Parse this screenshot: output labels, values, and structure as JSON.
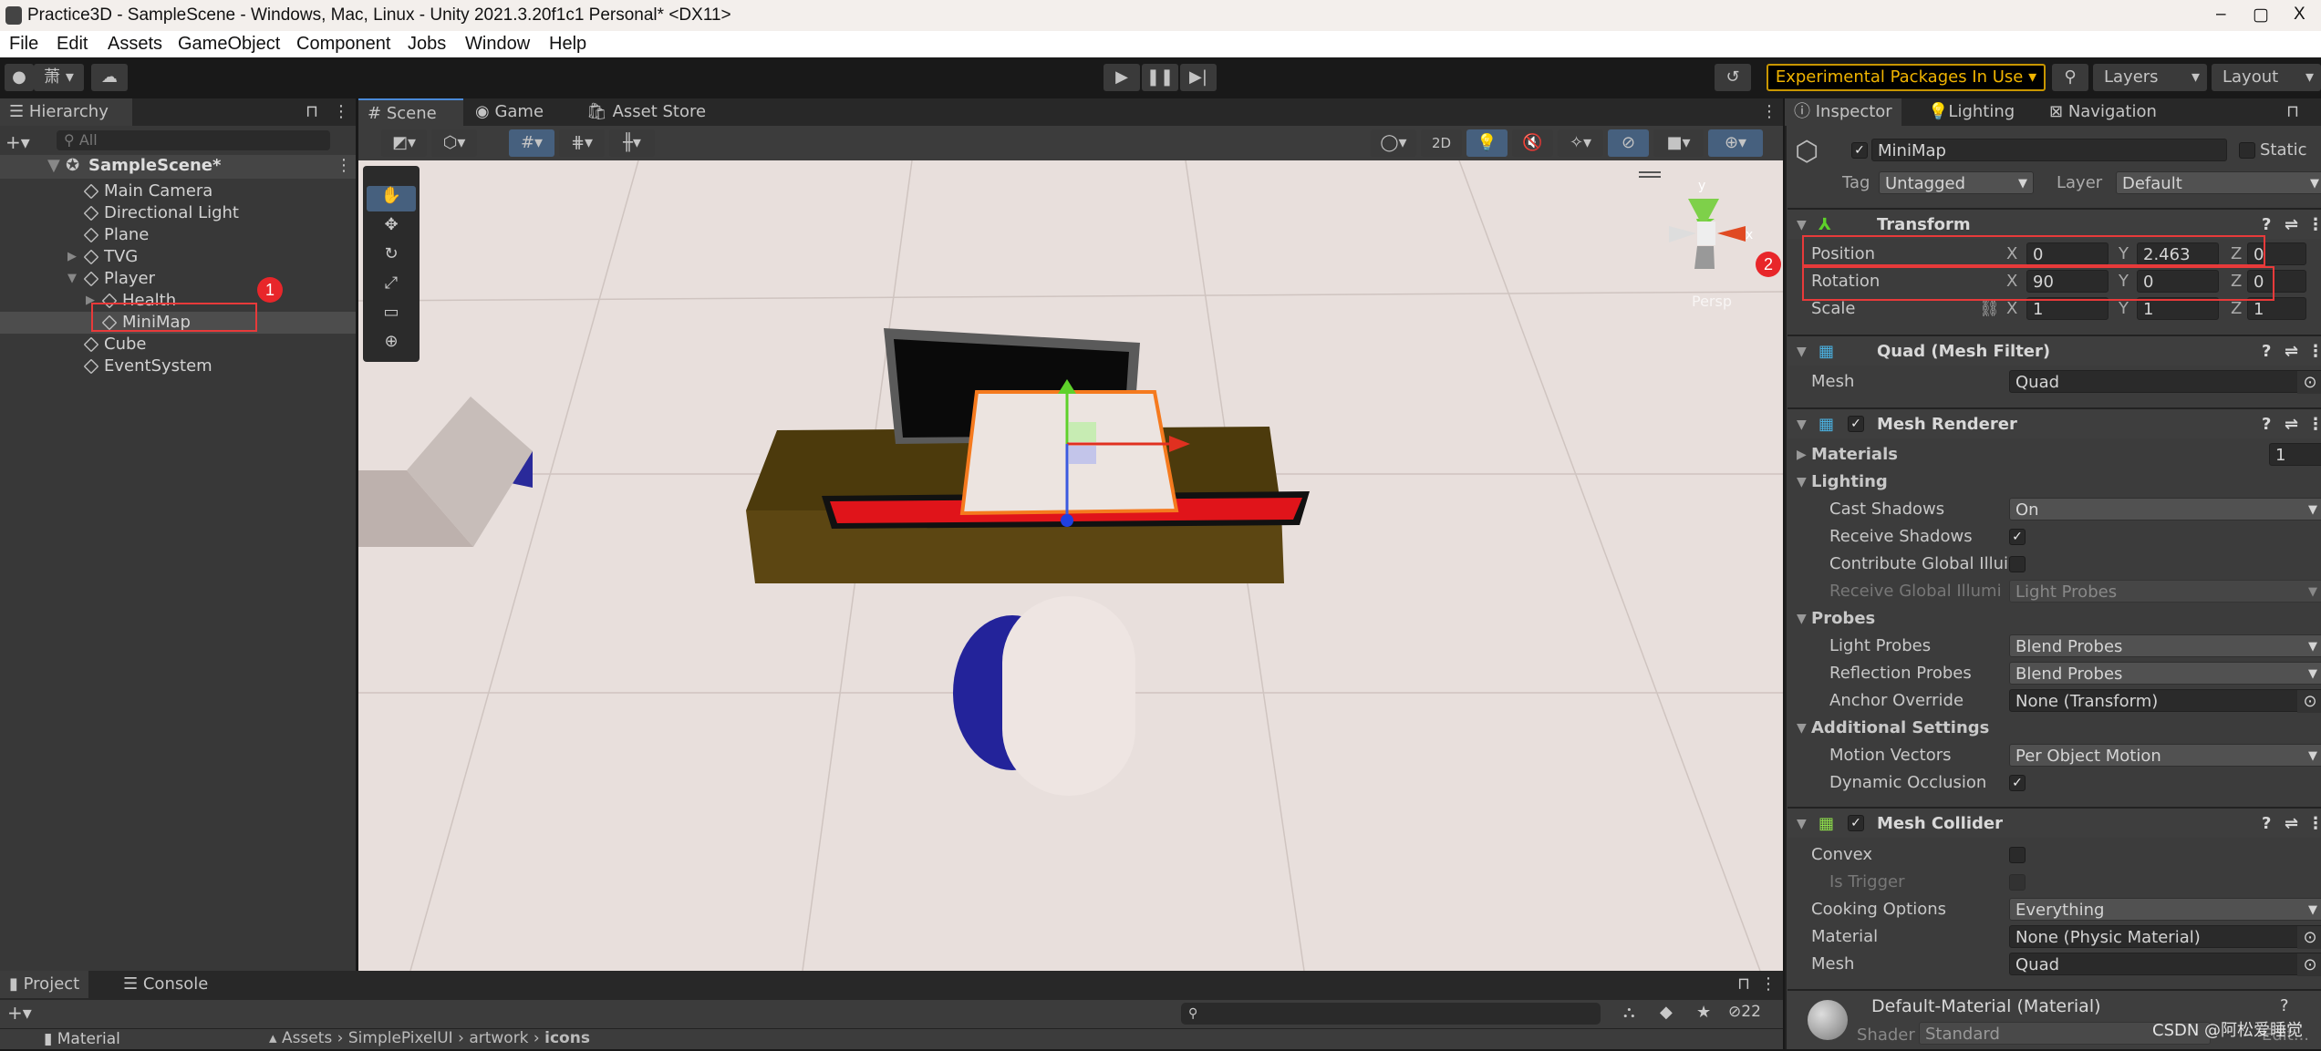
{
  "window": {
    "title": "Practice3D - SampleScene - Windows, Mac, Linux - Unity 2021.3.20f1c1 Personal* <DX11>",
    "controls": [
      "–",
      "▢",
      "X"
    ]
  },
  "menu": [
    "File",
    "Edit",
    "Assets",
    "GameObject",
    "Component",
    "Jobs",
    "Window",
    "Help"
  ],
  "toolbar": {
    "account": "萧",
    "experimental": "Experimental Packages In Use ▾",
    "layers": "Layers",
    "layout": "Layout"
  },
  "hierarchy": {
    "tab": "Hierarchy",
    "search_placeholder": "All",
    "scene": "SampleScene*",
    "items": [
      {
        "label": "Main Camera",
        "depth": 1
      },
      {
        "label": "Directional Light",
        "depth": 1
      },
      {
        "label": "Plane",
        "depth": 1
      },
      {
        "label": "TVG",
        "depth": 1,
        "arrow": "▶"
      },
      {
        "label": "Player",
        "depth": 1,
        "arrow": "▼"
      },
      {
        "label": "Health",
        "depth": 2,
        "arrow": "▶"
      },
      {
        "label": "MiniMap",
        "depth": 2,
        "selected": true
      },
      {
        "label": "Cube",
        "depth": 1
      },
      {
        "label": "EventSystem",
        "depth": 1
      }
    ]
  },
  "annotations": {
    "one": "1",
    "two": "2"
  },
  "scene": {
    "tabs": [
      "Scene",
      "Game",
      "Asset Store"
    ],
    "btn_2d": "2D",
    "persp": "Persp",
    "axis_x": "x",
    "axis_y": "y",
    "colors": {
      "floor": "#e8dfdc",
      "table": "#5c4612",
      "bar": "#e0141a",
      "selection": "#f57a1e"
    }
  },
  "inspector": {
    "tabs": [
      "Inspector",
      "Lighting",
      "Navigation"
    ],
    "name": "MiniMap",
    "static": "Static",
    "tag_label": "Tag",
    "tag": "Untagged",
    "layer_label": "Layer",
    "layer": "Default",
    "transform": {
      "title": "Transform",
      "rows": [
        {
          "label": "Position",
          "x": "0",
          "y": "2.463",
          "z": "0"
        },
        {
          "label": "Rotation",
          "x": "90",
          "y": "0",
          "z": "0"
        },
        {
          "label": "Scale",
          "x": "1",
          "y": "1",
          "z": "1"
        }
      ]
    },
    "mesh_filter": {
      "title": "Quad (Mesh Filter)",
      "mesh_label": "Mesh",
      "mesh": "Quad"
    },
    "mesh_renderer": {
      "title": "Mesh Renderer",
      "materials_label": "Materials",
      "materials_count": "1",
      "lighting": "Lighting",
      "cast_shadows_label": "Cast Shadows",
      "cast_shadows": "On",
      "receive_shadows_label": "Receive Shadows",
      "receive_shadows": true,
      "contribute_gi_label": "Contribute Global Illui",
      "contribute_gi": false,
      "receive_gi_label": "Receive Global Illumi",
      "receive_gi": "Light Probes",
      "probes": "Probes",
      "light_probes_label": "Light Probes",
      "light_probes": "Blend Probes",
      "reflection_probes_label": "Reflection Probes",
      "reflection_probes": "Blend Probes",
      "anchor_label": "Anchor Override",
      "anchor": "None (Transform)",
      "additional": "Additional Settings",
      "motion_label": "Motion Vectors",
      "motion": "Per Object Motion",
      "dynamic_label": "Dynamic Occlusion",
      "dynamic": true
    },
    "mesh_collider": {
      "title": "Mesh Collider",
      "convex_label": "Convex",
      "trigger_label": "Is Trigger",
      "cooking_label": "Cooking Options",
      "cooking": "Everything",
      "material_label": "Material",
      "material": "None (Physic Material)",
      "mesh_label": "Mesh",
      "mesh": "Quad"
    },
    "material": {
      "title": "Default-Material (Material)",
      "shader_label": "Shader",
      "shader": "Standard",
      "edit": "Edit..."
    }
  },
  "project": {
    "tabs": [
      "Project",
      "Console"
    ],
    "folder": "Material",
    "breadcrumb": [
      "Assets",
      "SimplePixelUI",
      "artwork",
      "icons"
    ],
    "hidden_count": "22"
  },
  "watermark": "CSDN @阿松爱睡觉"
}
